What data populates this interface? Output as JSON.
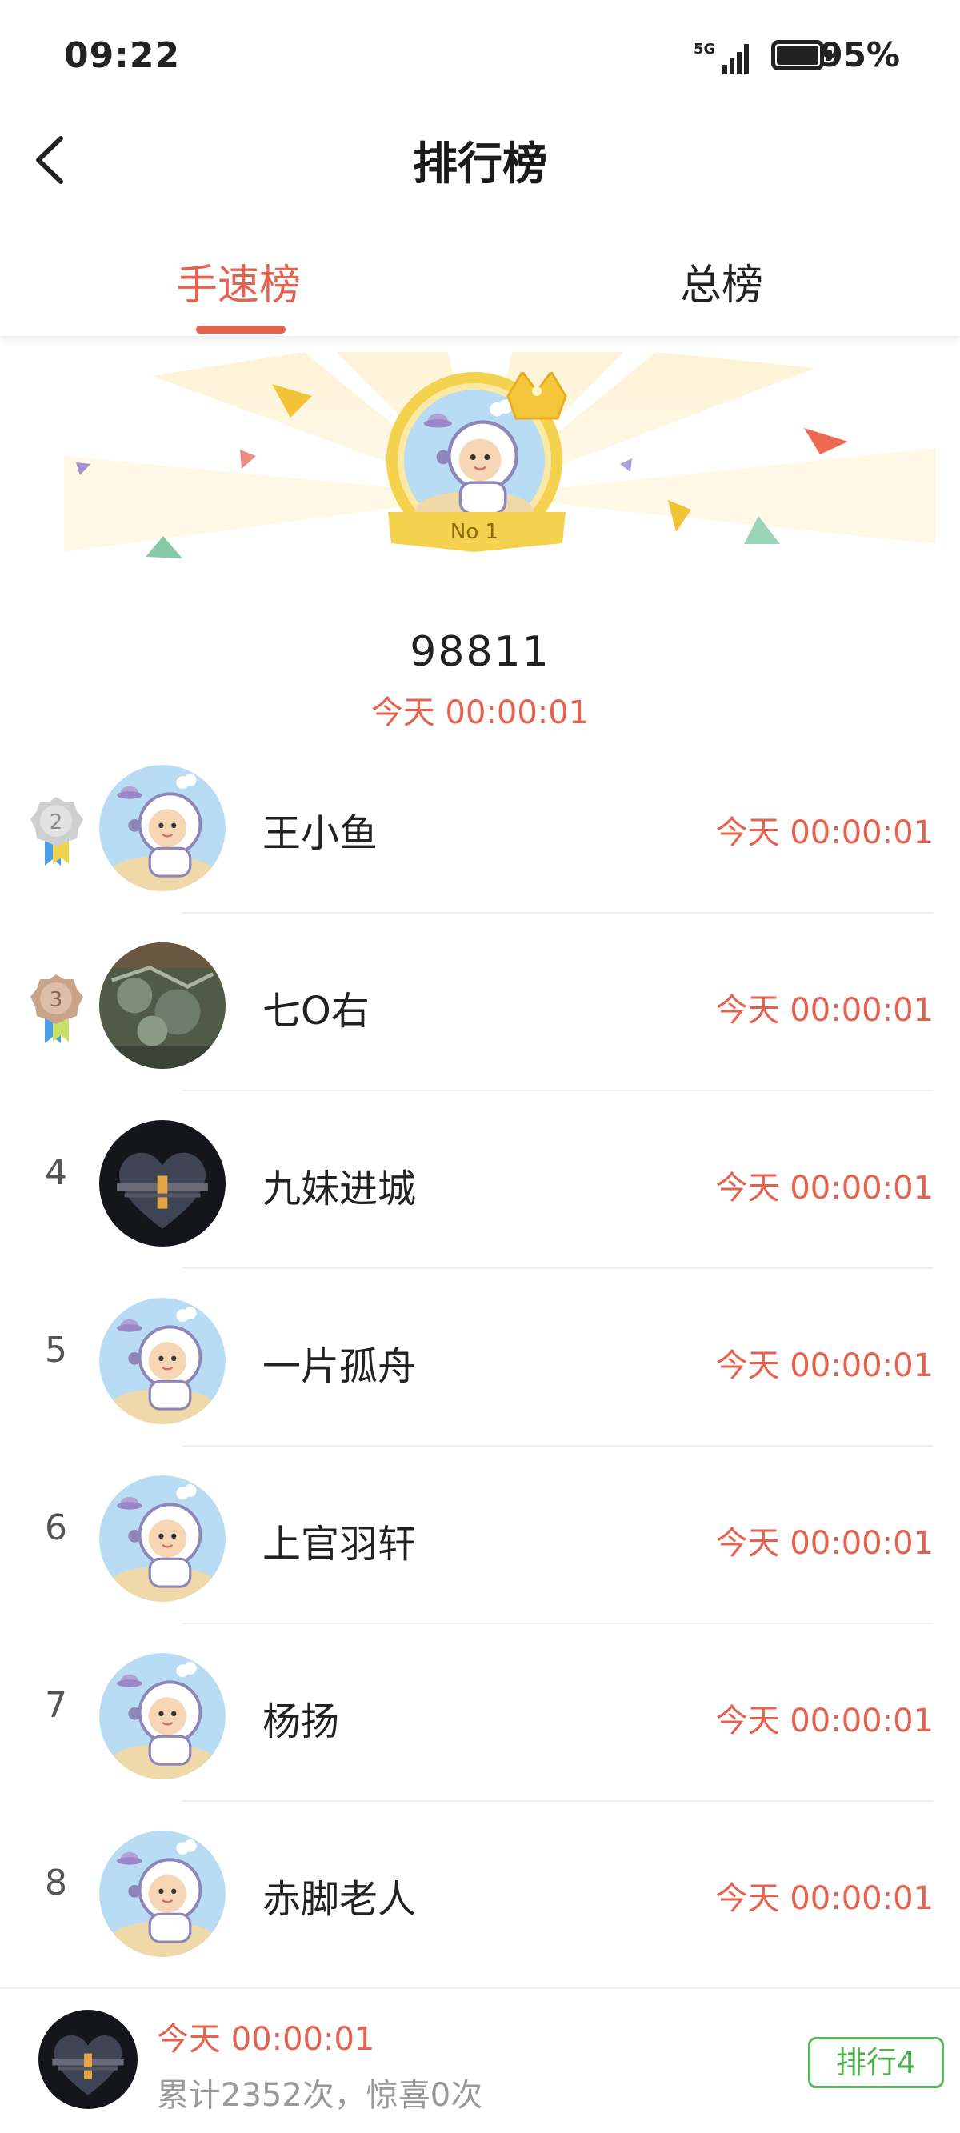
{
  "status_bar": {
    "time": "09:22",
    "network": "5G",
    "battery": "95%"
  },
  "header": {
    "title": "排行榜"
  },
  "tabs": [
    {
      "label": "手速榜",
      "active": true
    },
    {
      "label": "总榜",
      "active": false
    }
  ],
  "champion": {
    "badge": "No 1",
    "score": "98811",
    "time": "今天 00:00:01"
  },
  "ranking": [
    {
      "rank": "2",
      "name": "王小鱼",
      "time": "今天 00:00:01",
      "avatar": "astronaut"
    },
    {
      "rank": "3",
      "name": "七O右",
      "time": "今天 00:00:01",
      "avatar": "photo"
    },
    {
      "rank": "4",
      "name": "九妹进城",
      "time": "今天 00:00:01",
      "avatar": "sunset-heart"
    },
    {
      "rank": "5",
      "name": "一片孤舟",
      "time": "今天 00:00:01",
      "avatar": "astronaut"
    },
    {
      "rank": "6",
      "name": "上官羽轩",
      "time": "今天 00:00:01",
      "avatar": "astronaut"
    },
    {
      "rank": "7",
      "name": "杨扬",
      "time": "今天 00:00:01",
      "avatar": "astronaut"
    },
    {
      "rank": "8",
      "name": "赤脚老人",
      "time": "今天 00:00:01",
      "avatar": "astronaut"
    }
  ],
  "my_status": {
    "time": "今天 00:00:01",
    "stats": "累计2352次，惊喜0次",
    "rank_button": "排行4",
    "avatar": "sunset-heart"
  },
  "colors": {
    "accent": "#e5624f",
    "rank_button": "#5cb85c",
    "silver_medal": "#c8c8c8",
    "bronze_medal": "#c9a48a"
  }
}
